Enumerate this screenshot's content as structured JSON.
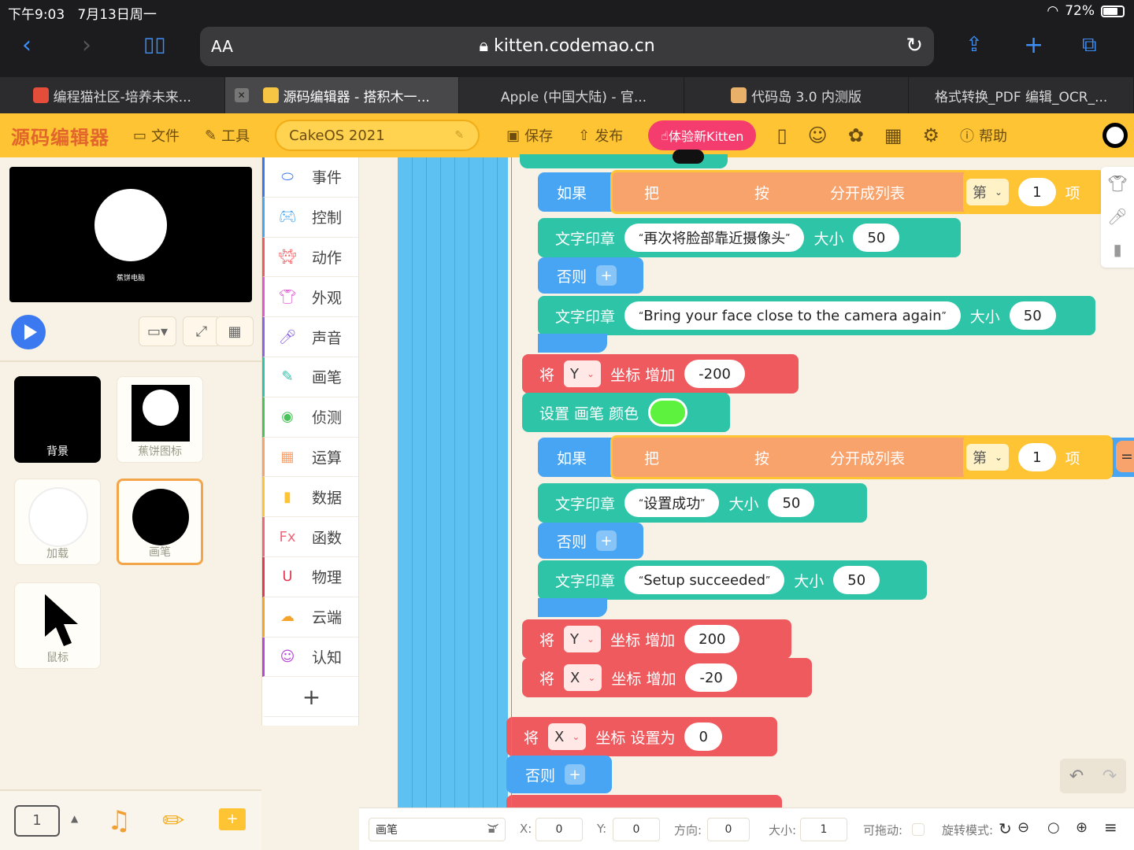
{
  "status": {
    "time": "下午9:03",
    "date": "7月13日周一",
    "battery": "72%"
  },
  "browser": {
    "aa": "AA",
    "url": "kitten.codemao.cn"
  },
  "tabs": [
    {
      "label": "编程猫社区-培养未来..."
    },
    {
      "label": "源码编辑器 - 搭积木一..."
    },
    {
      "label": "Apple (中国大陆) - 官..."
    },
    {
      "label": "代码岛 3.0 内测版"
    },
    {
      "label": "格式转换_PDF 编辑_OCR_..."
    }
  ],
  "toolbar": {
    "logo": "源码编辑器",
    "file": "文件",
    "tools": "工具",
    "project": "CakeOS 2021",
    "save": "保存",
    "publish": "发布",
    "kitten": "体验新Kitten",
    "help": "帮助"
  },
  "stage": {
    "caption": "蕉饼电脑"
  },
  "sprites": [
    {
      "label": "背景"
    },
    {
      "label": "蕉饼图标"
    },
    {
      "label": "加载"
    },
    {
      "label": "画笔"
    },
    {
      "label": "鼠标"
    }
  ],
  "scene_number": "1",
  "categories": [
    {
      "label": "事件",
      "color": "#3b79f0"
    },
    {
      "label": "控制",
      "color": "#48a5f3"
    },
    {
      "label": "动作",
      "color": "#ef5a5f"
    },
    {
      "label": "外观",
      "color": "#e257d2"
    },
    {
      "label": "声音",
      "color": "#8a63e6"
    },
    {
      "label": "画笔",
      "color": "#2ec4a8"
    },
    {
      "label": "侦测",
      "color": "#49c25a"
    },
    {
      "label": "运算",
      "color": "#f8a26c"
    },
    {
      "label": "数据",
      "color": "#fec433"
    },
    {
      "label": "函数",
      "color": "#f0677d"
    },
    {
      "label": "物理",
      "color": "#e23a55"
    },
    {
      "label": "云端",
      "color": "#f6a32b"
    },
    {
      "label": "认知",
      "color": "#b848d8"
    }
  ],
  "cats_add": "+",
  "blocks": {
    "if": "如果",
    "else": "否则",
    "split_a": "把",
    "split_b": "按",
    "split_c": "分开成列表",
    "nth": "第",
    "one": "1",
    "item": "项",
    "stamp": "文字印章",
    "size": "大小",
    "size_val": "50",
    "t1": "再次将脸部靠近摄像头",
    "t2": "Bring your face close to the camera again",
    "t3": "设置成功",
    "t4": "Setup succeeded",
    "set": "将",
    "y": "Y",
    "x": "X",
    "coord_add": "坐标 增加",
    "coord_set": "坐标 设置为",
    "v1": "-200",
    "v2": "200",
    "v3": "-20",
    "v4": "0",
    "pen_color": "设置 画笔 颜色",
    "pen_color_hex": "#5df23e",
    "eq": "="
  },
  "props": {
    "name": "画笔",
    "x_label": "X:",
    "x": "0",
    "y_label": "Y:",
    "y": "0",
    "dir_label": "方向:",
    "dir": "0",
    "size_label": "大小:",
    "size": "1",
    "drag_label": "可拖动:",
    "rot_label": "旋转模式:"
  }
}
